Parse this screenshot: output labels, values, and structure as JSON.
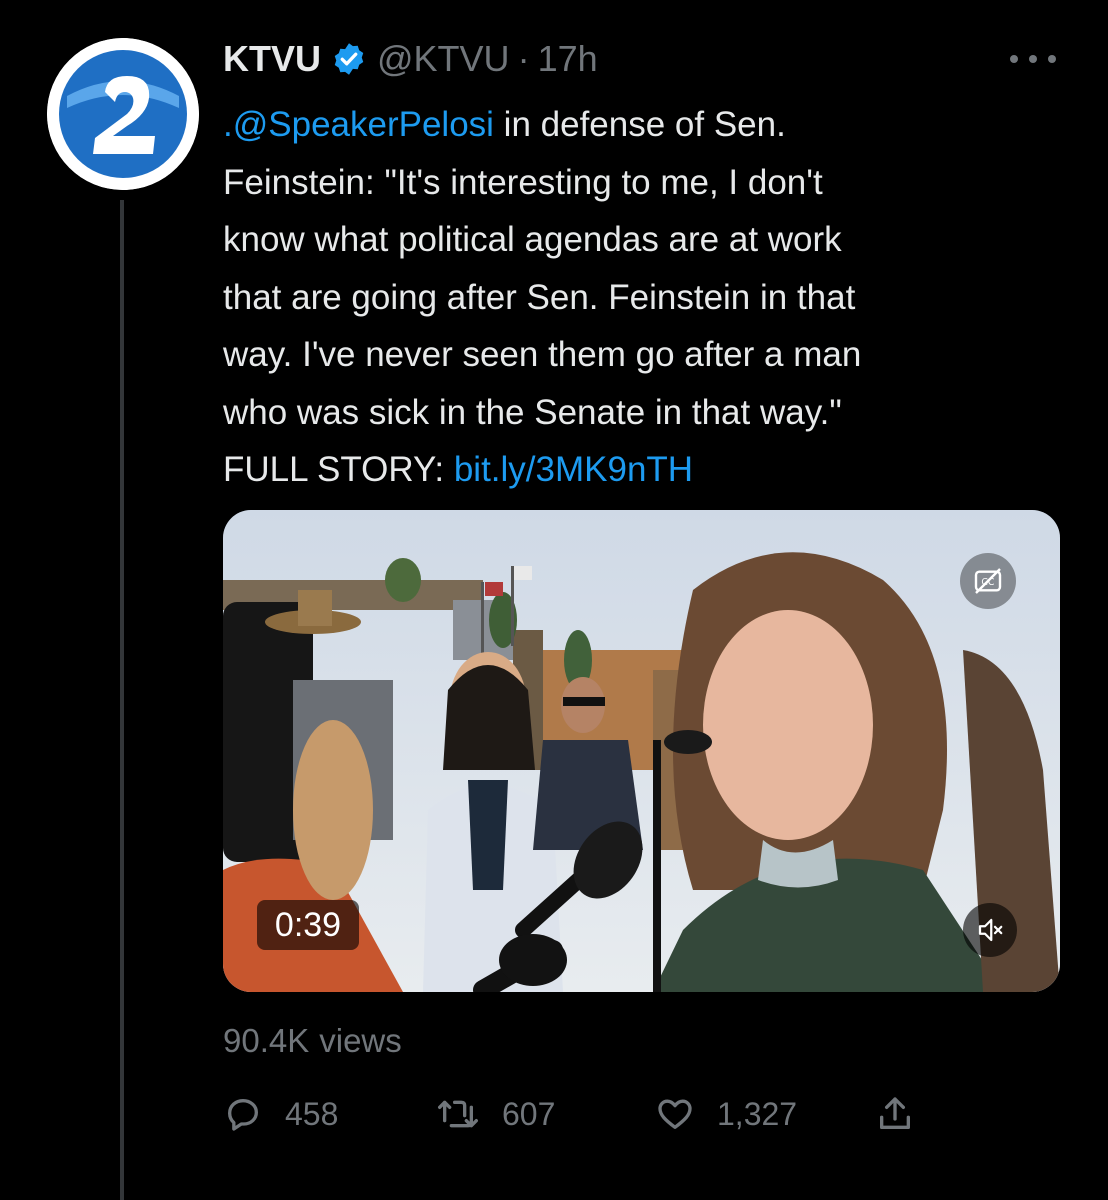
{
  "tweet": {
    "author_name": "KTVU",
    "handle": "@KTVU",
    "separator": "·",
    "time": "17h",
    "avatar_text": "2",
    "text_lines": [
      {
        "link": ".@SpeakerPelosi",
        "text": " in defense of Sen."
      },
      {
        "text": "Feinstein: \"It's interesting to me, I don't"
      },
      {
        "text": "know what political agendas are at work"
      },
      {
        "text": "that are going after Sen. Feinstein in that"
      },
      {
        "text": "way. I've never seen them go after a man"
      },
      {
        "text": "who was sick in the Senate in that way.\""
      },
      {
        "text": "FULL STORY: ",
        "link2": "bit.ly/3MK9nTH"
      }
    ],
    "media": {
      "duration": "0:39",
      "cc_icon": "closed-captions-off-icon",
      "mute_icon": "muted-speaker-icon"
    },
    "views": {
      "count": "90.4K",
      "label": "views"
    },
    "actions": {
      "replies": "458",
      "retweets": "607",
      "likes": "1,327"
    }
  },
  "colors": {
    "background": "#000000",
    "text": "#e7e9ea",
    "secondary": "#71767b",
    "link": "#1d9bf0",
    "verified": "#1d9bf0"
  }
}
